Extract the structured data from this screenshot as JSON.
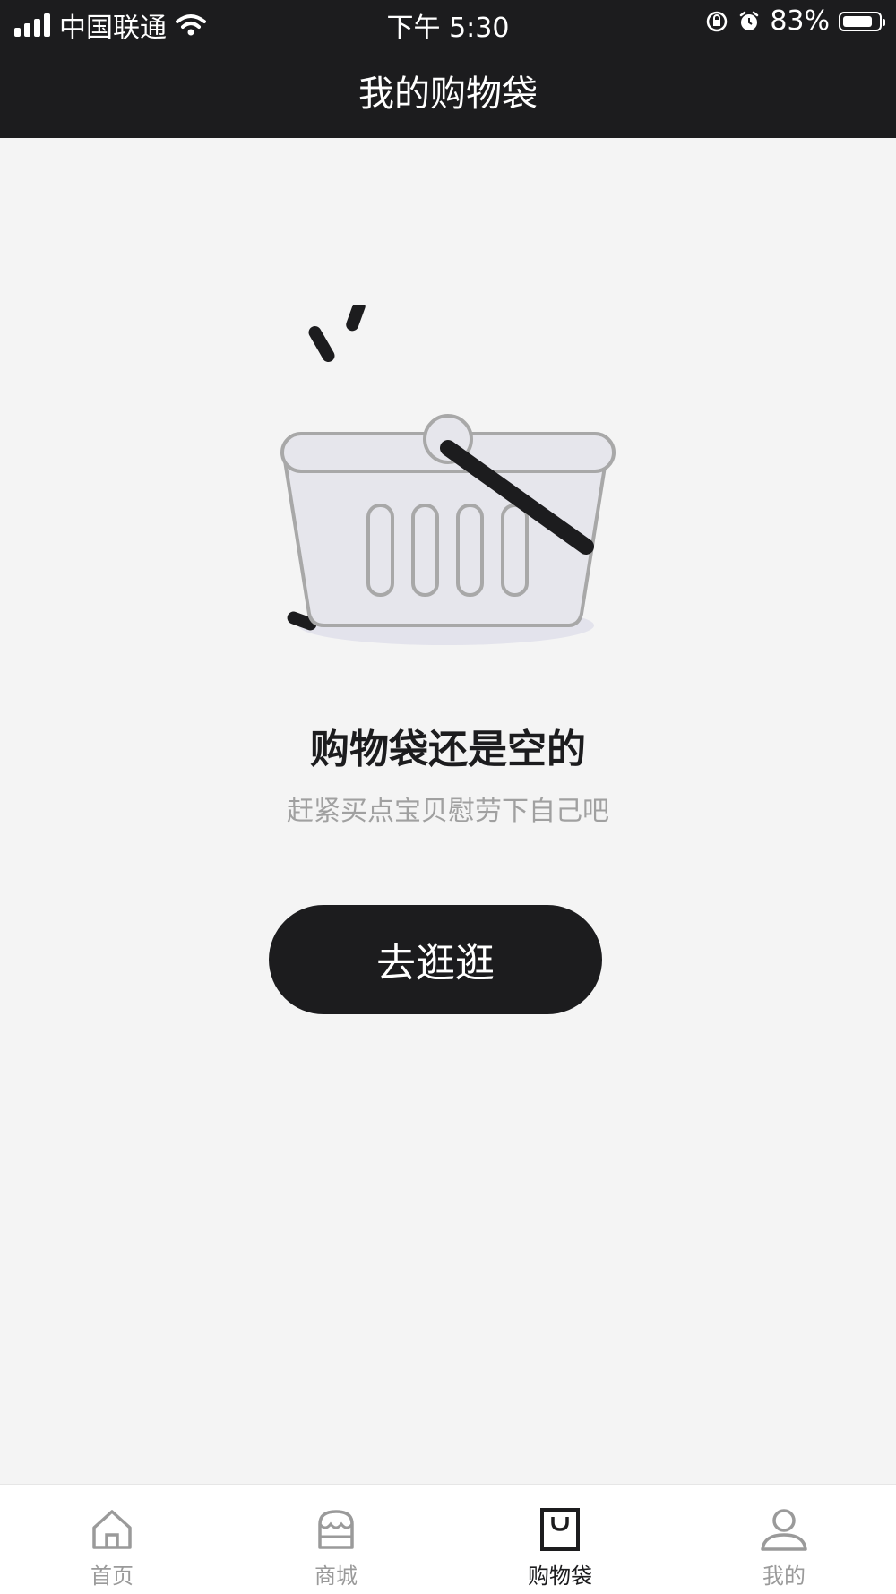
{
  "status_bar": {
    "carrier": "中国联通",
    "time": "下午 5:30",
    "battery": "83%",
    "battery_level": 0.83
  },
  "header": {
    "title": "我的购物袋"
  },
  "empty_state": {
    "title": "购物袋还是空的",
    "subtitle": "赶紧买点宝贝慰劳下自己吧",
    "button_label": "去逛逛"
  },
  "tabbar": {
    "items": [
      {
        "label": "首页",
        "icon": "home-icon",
        "active": false
      },
      {
        "label": "商城",
        "icon": "store-icon",
        "active": false
      },
      {
        "label": "购物袋",
        "icon": "shopping-bag-icon",
        "active": true
      },
      {
        "label": "我的",
        "icon": "profile-icon",
        "active": false
      }
    ]
  },
  "colors": {
    "header_bg": "#1c1c1e",
    "page_bg": "#f4f4f4",
    "button_bg": "#1c1c1e",
    "subtitle": "#a0a0a0",
    "tab_inactive": "#9a9a9a"
  }
}
